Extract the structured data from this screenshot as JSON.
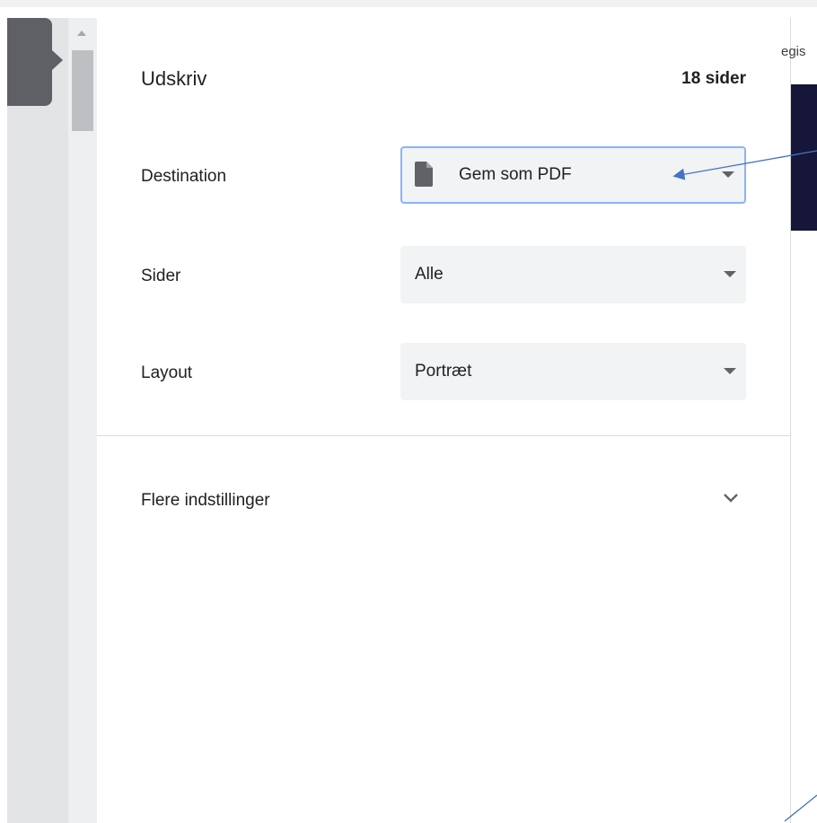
{
  "dialog": {
    "title": "Udskriv",
    "sheet_count": "18 sider"
  },
  "settings": {
    "destination": {
      "label": "Destination",
      "value": "Gem som PDF",
      "icon": "document-icon"
    },
    "pages": {
      "label": "Sider",
      "value": "Alle"
    },
    "layout": {
      "label": "Layout",
      "value": "Portræt"
    }
  },
  "more_settings": {
    "label": "Flere indstillinger",
    "icon": "chevron-down-icon"
  },
  "preview": {
    "partial_text": "egis"
  },
  "colors": {
    "focus_border": "#8ab4f8",
    "select_bg": "#f1f3f4",
    "preview_dark": "#15163a",
    "annotation_arrow": "#4472c4"
  }
}
